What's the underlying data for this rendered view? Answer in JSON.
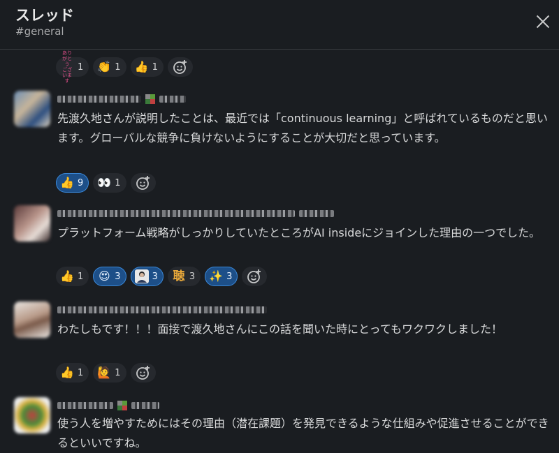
{
  "header": {
    "title": "スレッド",
    "channel": "#general"
  },
  "colors": {
    "background": "#1a1d21",
    "active_reaction": "#1d4f88",
    "text": "#d1d2d3"
  },
  "top_reactions": [
    {
      "emoji": "ありがとうございます",
      "emoji_name": "arigatou-icon",
      "count": "1"
    },
    {
      "emoji": "👏",
      "emoji_name": "clap-icon",
      "count": "1"
    },
    {
      "emoji": "👍",
      "emoji_name": "thumbsup-icon",
      "count": "1"
    }
  ],
  "messages": [
    {
      "text": "先渡久地さんが説明したことは、最近では「continuous learning」と呼ばれているものだと思います。グローバルな競争に負けないようにすることが大切だと思っています。",
      "reactions": [
        {
          "emoji": "👍",
          "emoji_name": "thumbsup-icon",
          "count": "9",
          "active": true
        },
        {
          "emoji": "👀",
          "emoji_name": "eyes-icon",
          "count": "1",
          "active": false
        }
      ]
    },
    {
      "text": "プラットフォーム戦略がしっかりしていたところがAI insideにジョインした理由の一つでした。",
      "reactions": [
        {
          "emoji": "👍",
          "emoji_name": "thumbsup-icon",
          "count": "1",
          "active": false
        },
        {
          "emoji": "😍",
          "emoji_name": "heart-eyes-icon",
          "count": "3",
          "active": true
        },
        {
          "emoji": "👤",
          "emoji_name": "person-portrait-icon",
          "count": "3",
          "active": true
        },
        {
          "emoji": "聴",
          "emoji_name": "kanji-emoji-icon",
          "count": "3",
          "active": false
        },
        {
          "emoji": "✨",
          "emoji_name": "sparkles-icon",
          "count": "3",
          "active": true
        }
      ]
    },
    {
      "text": "わたしもです！！！面接で渡久地さんにこの話を聞いた時にとってもワクワクしました！",
      "reactions": [
        {
          "emoji": "👍",
          "emoji_name": "thumbsup-icon",
          "count": "1",
          "active": false
        },
        {
          "emoji": "🙋",
          "emoji_name": "raising-hand-icon",
          "count": "1",
          "active": false
        }
      ]
    },
    {
      "text": "使う人を増やすためにはその理由（潜在課題）を発見できるような仕組みや促進させることができるといいですね。",
      "reactions": []
    }
  ]
}
